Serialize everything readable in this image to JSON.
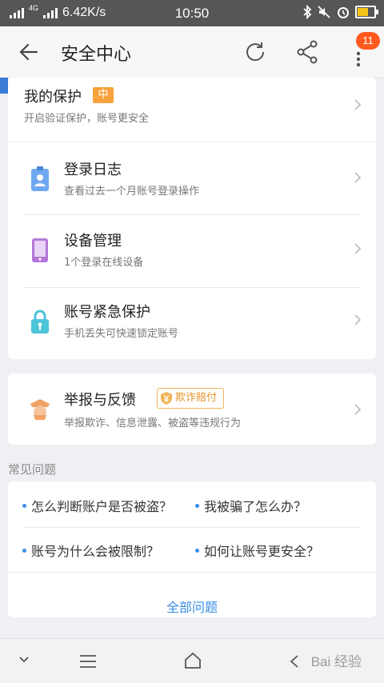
{
  "statusbar": {
    "network": "4G",
    "speed": "6.42K/s",
    "time": "10:50",
    "icons": [
      "bluetooth-icon",
      "mute-icon",
      "alarm-icon",
      "battery-icon"
    ]
  },
  "appbar": {
    "title": "安全中心",
    "badge_count": "11"
  },
  "protection": {
    "title": "我的保护",
    "level": "中",
    "subtitle": "开启验证保护，账号更安全"
  },
  "items": [
    {
      "title": "登录日志",
      "subtitle": "查看过去一个月账号登录操作",
      "icon": "badge-icon"
    },
    {
      "title": "设备管理",
      "subtitle": "1个登录在线设备",
      "icon": "tablet-icon"
    },
    {
      "title": "账号紧急保护",
      "subtitle": "手机丢失可快速锁定账号",
      "icon": "lock-icon"
    }
  ],
  "report": {
    "title": "举报与反馈",
    "tag": "欺诈赔付",
    "subtitle": "举报欺诈、信息泄露、被盗等违规行为"
  },
  "faq": {
    "heading": "常见问题",
    "questions": [
      "怎么判断账户是否被盗？",
      "我被骗了怎么办？",
      "账号为什么会被限制？",
      "如何让账号更安全？"
    ],
    "all_label": "全部问题"
  },
  "watermark": "Bai 经验",
  "colors": {
    "accent": "#3a8ee6",
    "orange": "#f7a23b",
    "badge": "#ff5a1f"
  }
}
